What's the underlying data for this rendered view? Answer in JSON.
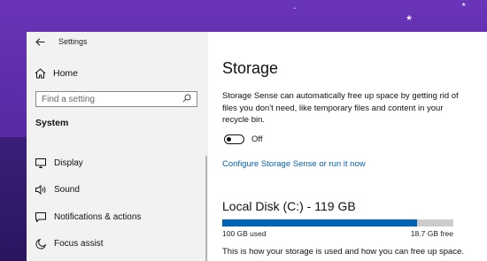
{
  "window": {
    "title": "Settings"
  },
  "sidebar": {
    "home_label": "Home",
    "search_placeholder": "Find a setting",
    "section_title": "System",
    "items": [
      {
        "label": "Display",
        "icon": "display-icon"
      },
      {
        "label": "Sound",
        "icon": "speaker-icon"
      },
      {
        "label": "Notifications & actions",
        "icon": "notifications-icon"
      },
      {
        "label": "Focus assist",
        "icon": "moon-icon"
      }
    ]
  },
  "main": {
    "title": "Storage",
    "description": "Storage Sense can automatically free up space by getting rid of files you don't need, like temporary files and content in your recycle bin.",
    "toggle_state": "Off",
    "configure_link": "Configure Storage Sense or run it now",
    "disk_title": "Local Disk (C:) - 119 GB",
    "used_label": "100 GB used",
    "free_label": "18.7 GB free",
    "used_fraction": 0.843,
    "footer_text": "This is how your storage is used and how you can free up space."
  },
  "colors": {
    "accent": "#0063b1",
    "wallpaper": "#5b2ea6",
    "sidebar_bg": "#f2f2f2"
  }
}
